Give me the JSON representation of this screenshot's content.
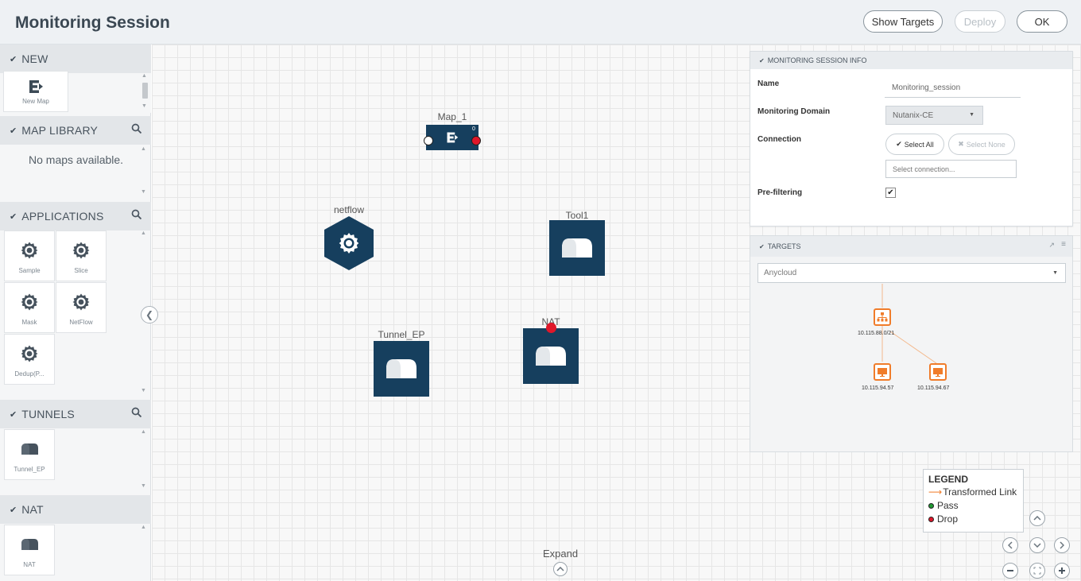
{
  "header": {
    "title": "Monitoring Session",
    "show_targets": "Show Targets",
    "deploy": "Deploy",
    "ok": "OK"
  },
  "sidebar": {
    "new": {
      "title": "NEW",
      "items": [
        {
          "label": "New Map",
          "icon": "map-icon"
        }
      ]
    },
    "map_library": {
      "title": "MAP LIBRARY",
      "empty": "No maps available."
    },
    "applications": {
      "title": "APPLICATIONS",
      "items": [
        {
          "label": "Sample",
          "icon": "gear-icon"
        },
        {
          "label": "Slice",
          "icon": "gear-icon"
        },
        {
          "label": "Mask",
          "icon": "gear-icon"
        },
        {
          "label": "NetFlow",
          "icon": "gear-icon"
        },
        {
          "label": "Dedup(P...",
          "icon": "gear-icon"
        }
      ]
    },
    "tunnels": {
      "title": "TUNNELS",
      "items": [
        {
          "label": "Tunnel_EP",
          "icon": "tunnel-icon"
        }
      ]
    },
    "nat": {
      "title": "NAT",
      "items": [
        {
          "label": "NAT",
          "icon": "tunnel-icon"
        }
      ]
    }
  },
  "canvas": {
    "nodes": {
      "map": {
        "label": "Map_1",
        "port_count": "0"
      },
      "netflow": {
        "label": "netflow"
      },
      "tool1": {
        "label": "Tool1"
      },
      "tunnel": {
        "label": "Tunnel_EP"
      },
      "nat": {
        "label": "NAT"
      }
    },
    "expand": "Expand"
  },
  "info_panel": {
    "title": "MONITORING SESSION INFO",
    "name_label": "Name",
    "name_value": "Monitoring_session",
    "domain_label": "Monitoring Domain",
    "domain_value": "Nutanix-CE",
    "connection_label": "Connection",
    "select_all": "Select All",
    "select_none": "Select None",
    "select_connection": "Select connection...",
    "prefilter_label": "Pre-filtering",
    "prefilter_checked": true
  },
  "targets_panel": {
    "title": "TARGETS",
    "cloud_select": "Anycloud",
    "subnet": "10.115.88.0/21",
    "hosts": [
      "10.115.94.57",
      "10.115.94.67"
    ]
  },
  "legend": {
    "title": "LEGEND",
    "transformed": "Transformed Link",
    "pass": "Pass",
    "drop": "Drop"
  },
  "colors": {
    "node_fill": "#163f5e",
    "accent_orange": "#f07c2a",
    "pass": "#1f9a32",
    "drop": "#e0172a"
  }
}
